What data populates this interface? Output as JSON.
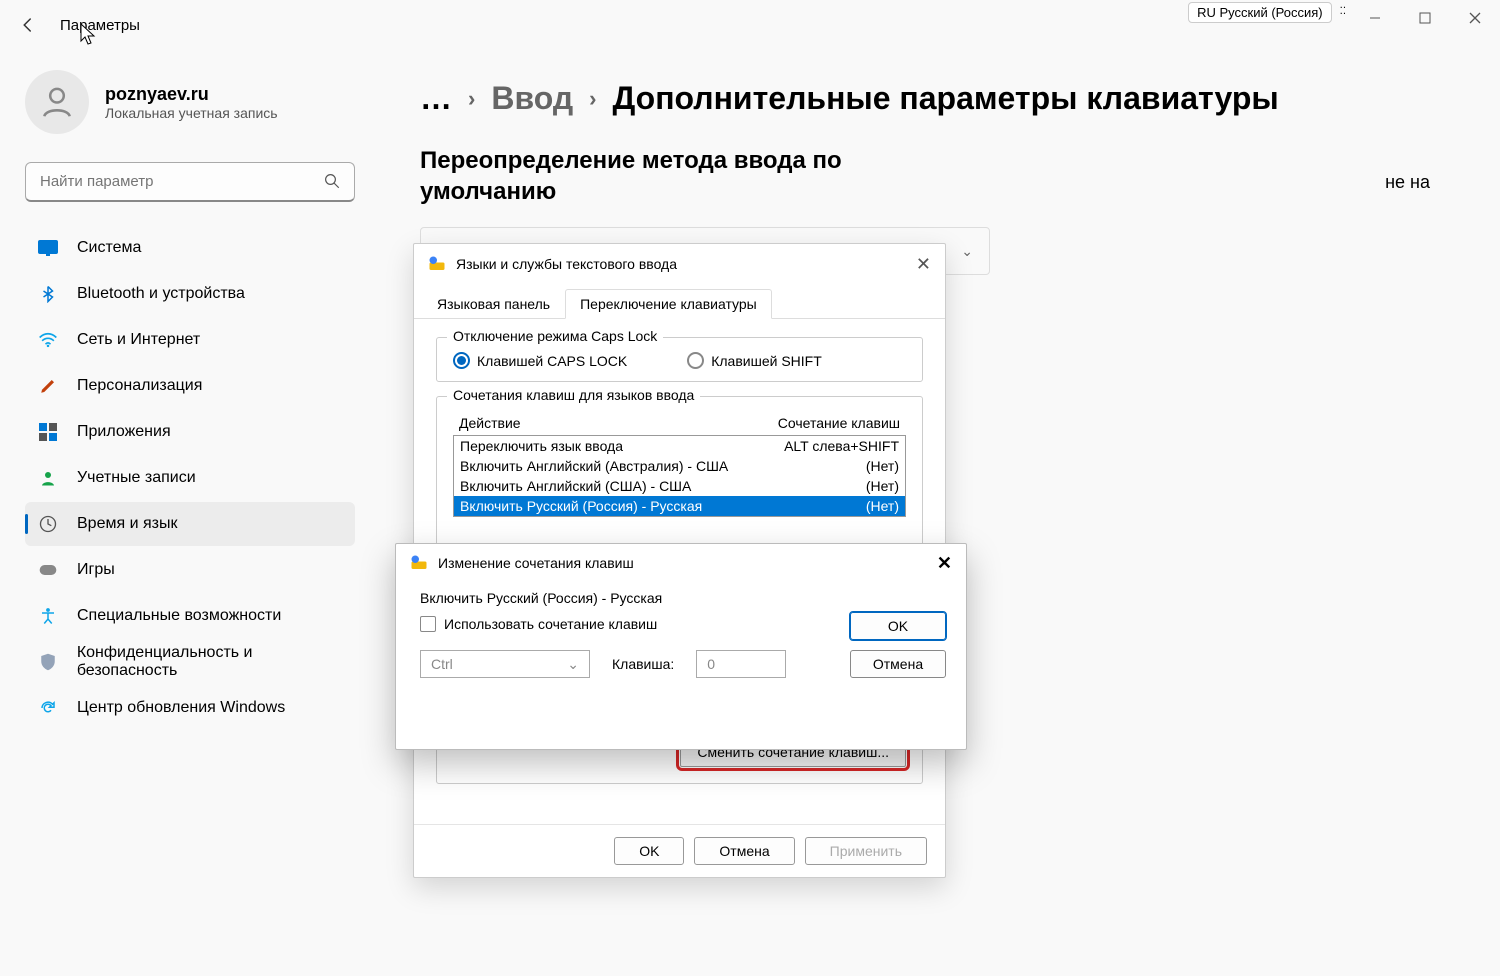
{
  "app_title": "Параметры",
  "lang_indicator": "RU Русский (Россия)",
  "user": {
    "name": "poznyaev.ru",
    "role": "Локальная учетная запись"
  },
  "search_placeholder": "Найти параметр",
  "nav": [
    {
      "label": "Система"
    },
    {
      "label": "Bluetooth и устройства"
    },
    {
      "label": "Сеть и Интернет"
    },
    {
      "label": "Персонализация"
    },
    {
      "label": "Приложения"
    },
    {
      "label": "Учетные записи"
    },
    {
      "label": "Время и язык"
    },
    {
      "label": "Игры"
    },
    {
      "label": "Специальные возможности"
    },
    {
      "label": "Конфиденциальность и безопасность"
    },
    {
      "label": "Центр обновления Windows"
    }
  ],
  "breadcrumb": {
    "ellipsis": "…",
    "parent": "Ввод",
    "current": "Дополнительные параметры клавиатуры"
  },
  "section_heading": "Переопределение метода ввода по умолчанию",
  "truncated_hint": "не на",
  "dialog1": {
    "title": "Языки и службы текстового ввода",
    "tabs": [
      "Языковая панель",
      "Переключение клавиатуры"
    ],
    "group_caps": {
      "legend": "Отключение режима Caps Lock",
      "opt1": "Клавишей CAPS LOCK",
      "opt2": "Клавишей SHIFT"
    },
    "group_hotkeys": {
      "legend": "Сочетания клавиш для языков ввода",
      "header_action": "Действие",
      "header_keys": "Сочетание клавиш",
      "rows": [
        {
          "a": "Переключить язык ввода",
          "k": "ALT слева+SHIFT"
        },
        {
          "a": "Включить Английский (Австралия) - США",
          "k": "(Нет)"
        },
        {
          "a": "Включить Английский (США) - США",
          "k": "(Нет)"
        },
        {
          "a": "Включить Русский (Россия) - Русская",
          "k": "(Нет)"
        }
      ],
      "change_btn": "Сменить сочетание клавиш..."
    },
    "footer": {
      "ok": "OK",
      "cancel": "Отмена",
      "apply": "Применить"
    }
  },
  "dialog2": {
    "title": "Изменение сочетания клавиш",
    "lang_line": "Включить Русский (Россия) - Русская",
    "checkbox_label": "Использовать сочетание клавиш",
    "modifier": "Ctrl",
    "key_label": "Клавиша:",
    "key_value": "0",
    "ok": "OK",
    "cancel": "Отмена"
  }
}
